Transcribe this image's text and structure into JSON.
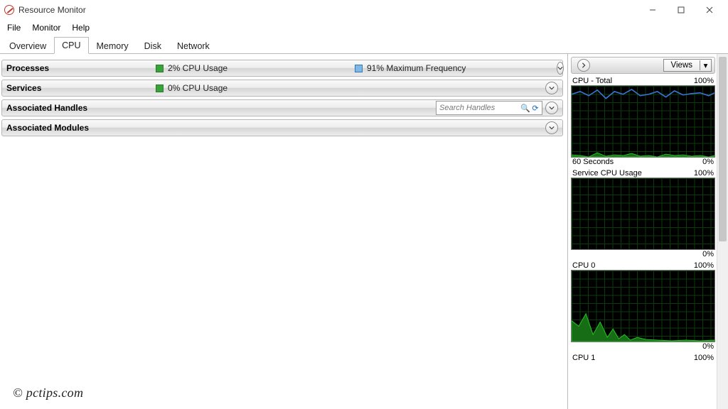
{
  "title": "Resource Monitor",
  "menu": {
    "file": "File",
    "monitor": "Monitor",
    "help": "Help"
  },
  "tabs": {
    "overview": "Overview",
    "cpu": "CPU",
    "memory": "Memory",
    "disk": "Disk",
    "network": "Network",
    "active": "cpu"
  },
  "sections": {
    "processes": {
      "title": "Processes",
      "m1": "2% CPU Usage",
      "m2": "91% Maximum Frequency"
    },
    "services": {
      "title": "Services",
      "m1": "0% CPU Usage"
    },
    "handles": {
      "title": "Associated Handles",
      "search_ph": "Search Handles"
    },
    "modules": {
      "title": "Associated Modules"
    }
  },
  "right": {
    "views": "Views"
  },
  "charts": {
    "cpu_total": {
      "title": "CPU - Total",
      "top_r": "100%",
      "bot_l": "60 Seconds",
      "bot_r": "0%"
    },
    "service": {
      "title": "Service CPU Usage",
      "top_r": "100%",
      "bot_r": "0%"
    },
    "cpu0": {
      "title": "CPU 0",
      "top_r": "100%",
      "bot_r": "0%"
    },
    "cpu1": {
      "title": "CPU 1",
      "top_r": "100%"
    }
  },
  "chart_data": [
    {
      "type": "line",
      "title": "CPU - Total",
      "ylim": [
        0,
        100
      ],
      "x_seconds": 60,
      "series": [
        {
          "name": "Maximum Frequency",
          "color": "#3a76d8",
          "values": [
            90,
            92,
            88,
            95,
            85,
            92,
            90,
            96,
            88,
            90,
            93,
            86,
            94,
            89,
            91,
            90,
            92,
            88
          ]
        },
        {
          "name": "CPU Usage",
          "color": "#25c425",
          "values": [
            3,
            2,
            0,
            6,
            1,
            3,
            2,
            5,
            1,
            2,
            0,
            4,
            2,
            3,
            1,
            2,
            0,
            2
          ]
        }
      ]
    },
    {
      "type": "line",
      "title": "Service CPU Usage",
      "ylim": [
        0,
        100
      ],
      "x_seconds": 60,
      "series": [
        {
          "name": "Service CPU",
          "color": "#25c425",
          "values": [
            0,
            0,
            0,
            0,
            0,
            0,
            0,
            0,
            0,
            0,
            0,
            0,
            0,
            0,
            0,
            0,
            0,
            0
          ]
        }
      ]
    },
    {
      "type": "line",
      "title": "CPU 0",
      "ylim": [
        0,
        100
      ],
      "x_seconds": 60,
      "series": [
        {
          "name": "CPU 0",
          "color": "#25c425",
          "values": [
            30,
            22,
            40,
            10,
            28,
            6,
            18,
            4,
            10,
            2,
            6,
            3,
            2,
            2,
            1,
            2,
            1,
            2
          ]
        }
      ]
    },
    {
      "type": "line",
      "title": "CPU 1",
      "ylim": [
        0,
        100
      ],
      "x_seconds": 60,
      "series": [
        {
          "name": "CPU 1",
          "color": "#25c425",
          "values": []
        }
      ]
    }
  ],
  "watermark": "© pctips.com"
}
